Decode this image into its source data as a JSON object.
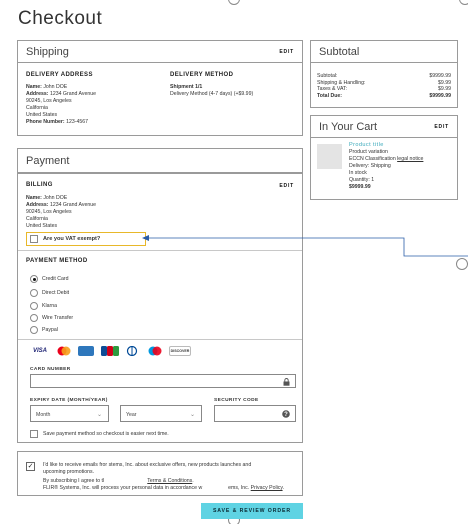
{
  "page_title": "Checkout",
  "shipping": {
    "title": "Shipping",
    "edit_label": "EDIT",
    "address_heading": "DELIVERY ADDRESS",
    "address_lines": [
      {
        "label": "Name:",
        "value": "John DOE"
      },
      {
        "label": "Address:",
        "value": "1234 Grand Avenue"
      },
      {
        "label": "",
        "value": "90245, Los Angeles"
      },
      {
        "label": "",
        "value": "California"
      },
      {
        "label": "",
        "value": "United States"
      },
      {
        "label": "Phone Number:",
        "value": "123-4567"
      }
    ],
    "method_heading": "DELIVERY METHOD",
    "shipment_label": "Shipment 1/1",
    "method_value": "Delivery Method (4-7 days) (+$9.99)"
  },
  "subtotal": {
    "title": "Subtotal",
    "rows": [
      {
        "label": "Subtotal:",
        "value": "$9999.99"
      },
      {
        "label": "Shipping & Handling:",
        "value": "$9.99"
      },
      {
        "label": "Taxes & VAT:",
        "value": "$9.99"
      },
      {
        "label": "Total Due:",
        "value": "$9999.99"
      }
    ]
  },
  "cart": {
    "title": "In Your Cart",
    "edit_label": "EDIT",
    "product_title": "Product title",
    "variation": "Product variation",
    "eccn_prefix": "ECCN Classification",
    "eccn_link": "legal notice",
    "delivery": "Delivery: Shipping",
    "stock": "In stock",
    "quantity": "Quantity: 1",
    "price": "$9999.99"
  },
  "payment": {
    "title": "Payment",
    "billing_heading": "BILLING",
    "edit_label": "EDIT",
    "billing_lines": [
      {
        "label": "Name:",
        "value": "John DOE"
      },
      {
        "label": "Address:",
        "value": "1234 Grand Avenue"
      },
      {
        "label": "",
        "value": "90245, Los Angeles"
      },
      {
        "label": "",
        "value": "California"
      },
      {
        "label": "",
        "value": "United States"
      }
    ],
    "vat_question": "Are you VAT exempt?",
    "method_heading": "PAYMENT METHOD",
    "methods": [
      "Credit Card",
      "Direct Debit",
      "Klarna",
      "Wire Transfer",
      "Paypal"
    ],
    "selected_method": "Credit Card",
    "card_logos": [
      "VISA",
      "MC",
      "AMEX",
      "JCB",
      "DINERS",
      "MAESTRO",
      "DISCOVER"
    ],
    "card_number_label": "CARD NUMBER",
    "card_number_value": "",
    "expiry_label": "EXPIRY DATE (MONTH/YEAR)",
    "month_placeholder": "Month",
    "year_placeholder": "Year",
    "security_label": "SECURITY CODE",
    "security_value": "",
    "save_method_label": "Save payment method so checkout is easier next time."
  },
  "consent": {
    "checked": true,
    "line1": "I'd like to receive emails fror                   stems, Inc. about exclusive offers, new products launches and",
    "line2": "upcoming promotions.",
    "line3_prefix": "By subscribing I agree to tl                              ",
    "terms_link": "Terms & Conditions",
    "line4_prefix": "FLIR® Systems, Inc. will process your personal data in accordance w                  ems, Inc.",
    "privacy_link": "Privacy Policy"
  },
  "submit_label": "SAVE & REVIEW ORDER",
  "colors": {
    "accent": "#5fd3e3",
    "highlight": "#e8b82a",
    "annotation": "#2a5ca8"
  }
}
